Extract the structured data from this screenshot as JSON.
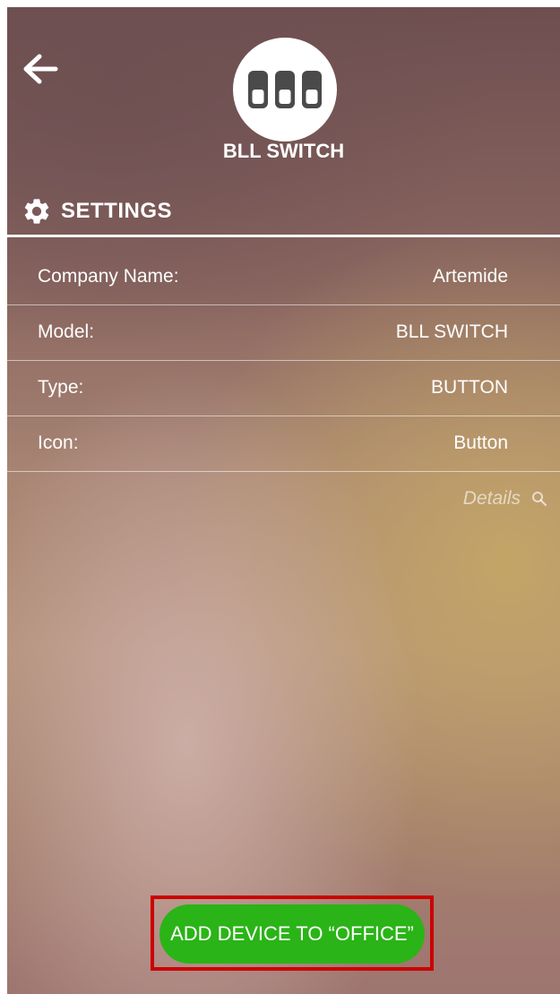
{
  "header": {
    "back_icon": "arrow-left-icon",
    "device_icon": "triple-switch-icon",
    "device_name": "BLL SWITCH"
  },
  "settings": {
    "icon": "gear-icon",
    "title": "SETTINGS",
    "rows": [
      {
        "label": "Company Name:",
        "value": "Artemide"
      },
      {
        "label": "Model:",
        "value": "BLL SWITCH"
      },
      {
        "label": "Type:",
        "value": "BUTTON"
      },
      {
        "label": "Icon:",
        "value": "Button"
      }
    ],
    "details_label": "Details",
    "details_icon": "magnifier-icon"
  },
  "action": {
    "add_button_label": "ADD DEVICE TO “OFFICE”",
    "button_color": "#2ab417",
    "highlight_color": "#cc0000"
  }
}
